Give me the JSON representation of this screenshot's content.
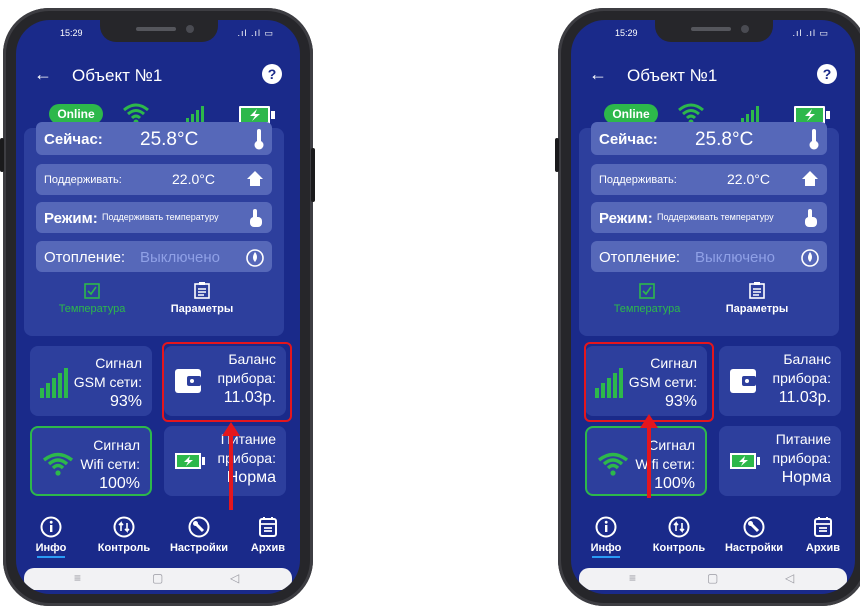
{
  "screens": [
    {
      "status": {
        "time": "15:29",
        "signal": ".ıl .ıl ▭"
      },
      "header": {
        "title": "Объект №1",
        "help": "?"
      },
      "connection": {
        "online": "Online"
      },
      "panel": {
        "now_label": "Сейчас:",
        "now_value": "25.8°C",
        "maintain_label": "Поддерживать:",
        "maintain_value": "22.0°C",
        "mode_label": "Режим:",
        "mode_value": "Поддерживать температуру",
        "heating_label": "Отопление:",
        "heating_value": "Выключено",
        "tab_temperature": "Температура",
        "tab_params": "Параметры"
      },
      "cards": {
        "gsm_line1": "Сигнал",
        "gsm_line2": "GSM сети:",
        "gsm_value": "93%",
        "balance_line1": "Баланс",
        "balance_line2": "прибора:",
        "balance_value": "11.03р.",
        "wifi_line1": "Сигнал",
        "wifi_line2": "Wifi сети:",
        "wifi_value": "100%",
        "power_line1": "Питание",
        "power_line2": "прибора:",
        "power_value": "Норма"
      },
      "nav": {
        "info": "Инфо",
        "control": "Контроль",
        "settings": "Настройки",
        "archive": "Архив"
      },
      "sysbar": {
        "menu": "≡",
        "home": "▢",
        "back": "◁"
      },
      "highlight": "balance"
    },
    {
      "status": {
        "time": "15:29",
        "signal": ".ıl .ıl ▭"
      },
      "header": {
        "title": "Объект №1",
        "help": "?"
      },
      "connection": {
        "online": "Online"
      },
      "panel": {
        "now_label": "Сейчас:",
        "now_value": "25.8°C",
        "maintain_label": "Поддерживать:",
        "maintain_value": "22.0°C",
        "mode_label": "Режим:",
        "mode_value": "Поддерживать температуру",
        "heating_label": "Отопление:",
        "heating_value": "Выключено",
        "tab_temperature": "Температура",
        "tab_params": "Параметры"
      },
      "cards": {
        "gsm_line1": "Сигнал",
        "gsm_line2": "GSM сети:",
        "gsm_value": "93%",
        "balance_line1": "Баланс",
        "balance_line2": "прибора:",
        "balance_value": "11.03р.",
        "wifi_line1": "Сигнал",
        "wifi_line2": "Wifi сети:",
        "wifi_value": "100%",
        "power_line1": "Питание",
        "power_line2": "прибора:",
        "power_value": "Норма"
      },
      "nav": {
        "info": "Инфо",
        "control": "Контроль",
        "settings": "Настройки",
        "archive": "Архив"
      },
      "sysbar": {
        "menu": "≡",
        "home": "▢",
        "back": "◁"
      },
      "highlight": "gsm"
    }
  ],
  "colors": {
    "accent_green": "#2db84b",
    "annotation_red": "#e4161d",
    "screen_bg": "#1a2a8a"
  }
}
